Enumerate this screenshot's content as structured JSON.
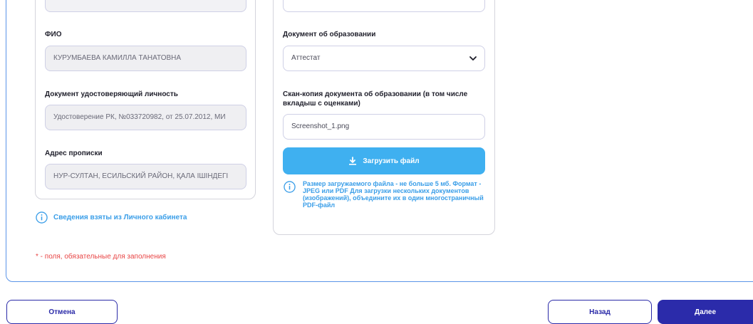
{
  "personal": {
    "fio_label": "ФИО",
    "fio_value": "КУРУМБАЕВА КАМИЛЛА ТАНАТОВНА",
    "id_doc_label": "Документ удостоверяющий личность",
    "id_doc_value": "Удостоверение РК, №033720982, от 25.07.2012, МИ",
    "address_label": "Адрес прописки",
    "address_value": "НУР-СУЛТАН, ЕСИЛЬСКИЙ РАЙОН, ҚАЛА ІШІНДЕГІ",
    "source_note": "Сведения взяты из Личного кабинета"
  },
  "education": {
    "doc_label": "Документ об образовании",
    "doc_selected": "Аттестат",
    "scan_label": "Скан-копия документа об образовании (в том числе вкладыш с оценками)",
    "scan_value": "Screenshot_1.png",
    "upload_label": "Загрузить файл",
    "upload_note": "Размер загружаемого файла - не больше 5 мб. Формат - JPEG или PDF Для загрузки нескольких документов (изображений), объедините их в один многостраничный PDF-файл"
  },
  "required_note": "* - поля, обязательные для заполнения",
  "footer": {
    "cancel_label": "Отмена",
    "back_label": "Назад",
    "next_label": "Далее"
  },
  "icons": {
    "info": "info-icon",
    "chevron": "chevron-down-icon",
    "upload": "upload-icon"
  },
  "colors": {
    "accent_blue": "#3fb0f0",
    "primary": "#2b2baa",
    "required": "#e84545",
    "info": "#3a9ee8"
  }
}
